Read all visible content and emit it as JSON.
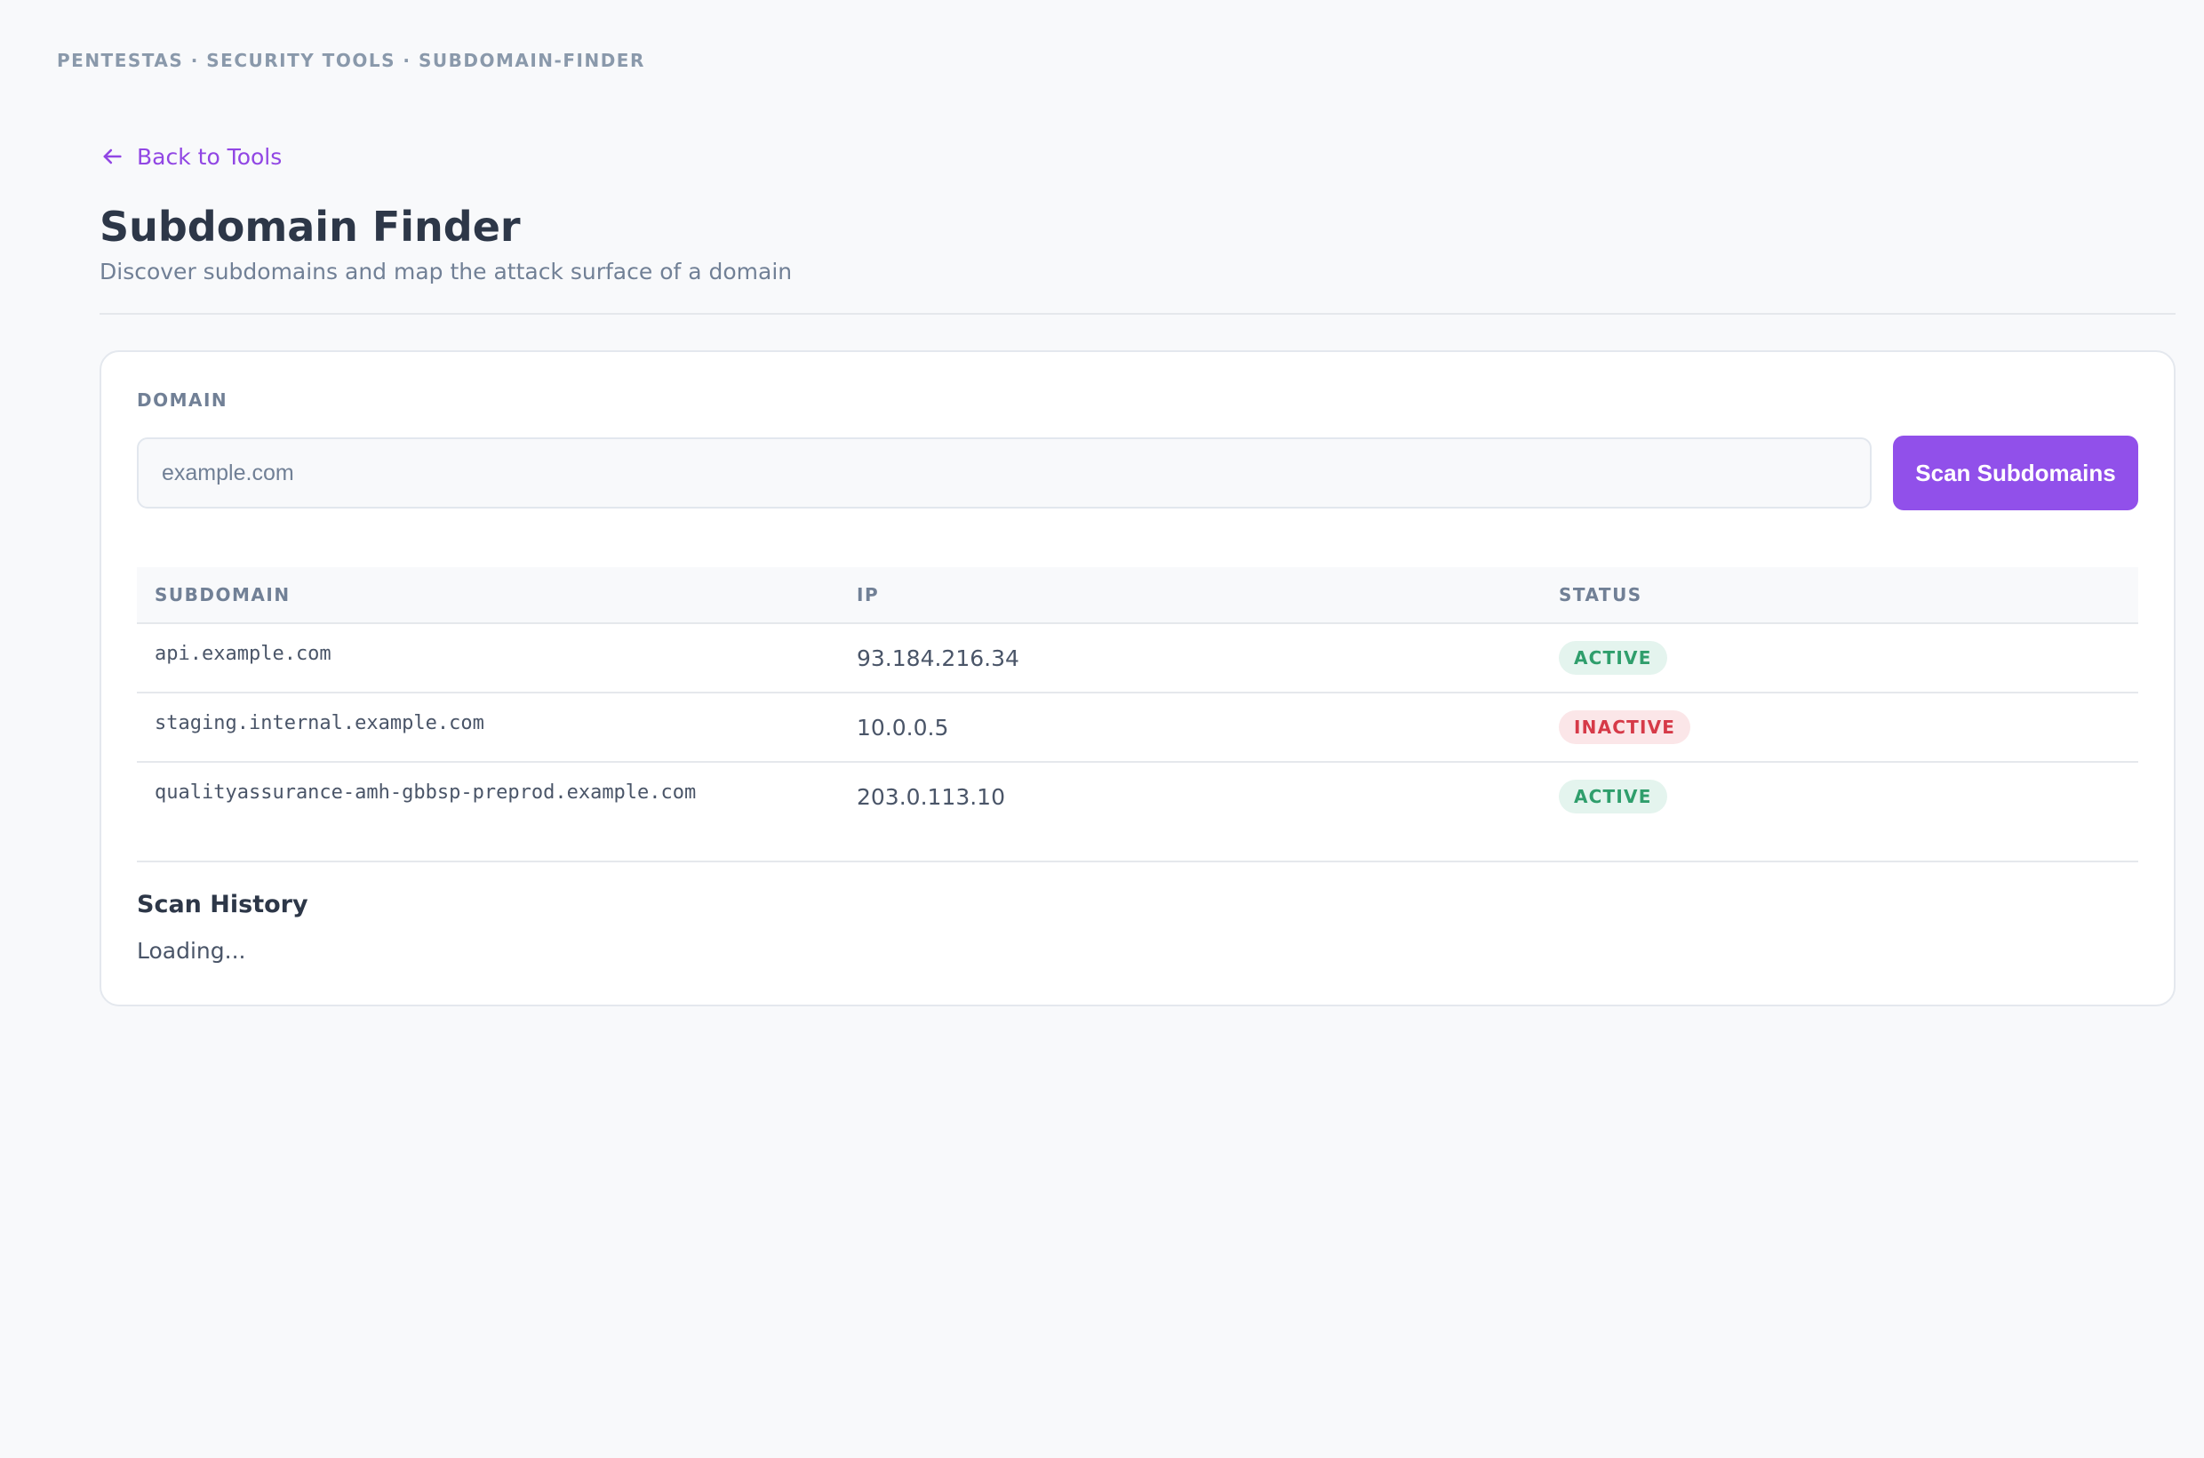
{
  "breadcrumb": "PENTESTAS · SECURITY TOOLS · SUBDOMAIN-FINDER",
  "back_link": {
    "label": "Back to Tools",
    "icon": "arrow-left-icon"
  },
  "page": {
    "title": "Subdomain Finder",
    "subtitle": "Discover subdomains and map the attack surface of a domain"
  },
  "form": {
    "label": "DOMAIN",
    "placeholder": "example.com",
    "value": "",
    "button_label": "Scan Subdomains"
  },
  "table": {
    "headers": {
      "subdomain": "SUBDOMAIN",
      "ip": "IP",
      "status": "STATUS"
    },
    "rows": [
      {
        "subdomain": "api.example.com",
        "ip": "93.184.216.34",
        "status": "ACTIVE",
        "status_type": "active"
      },
      {
        "subdomain": "staging.internal.example.com",
        "ip": "10.0.0.5",
        "status": "INACTIVE",
        "status_type": "inactive"
      },
      {
        "subdomain": "qualityassurance-amh-gbbsp-preprod.example.com",
        "ip": "203.0.113.10",
        "status": "ACTIVE",
        "status_type": "active"
      }
    ]
  },
  "history": {
    "title": "Scan History",
    "status": "Loading..."
  },
  "colors": {
    "accent": "#9150ea",
    "link": "#9146e4",
    "active_text": "#2f9e6c",
    "active_bg": "#e4f4ee",
    "inactive_text": "#d63a48",
    "inactive_bg": "#fbe6e8"
  }
}
